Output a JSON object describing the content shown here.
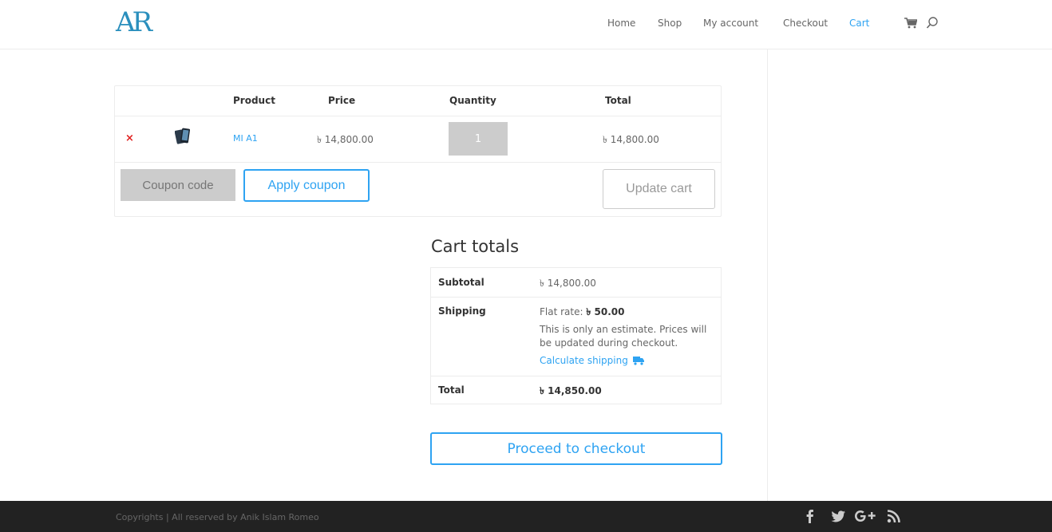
{
  "header": {
    "logo_text": "AR",
    "nav": [
      {
        "label": "Home"
      },
      {
        "label": "Shop"
      },
      {
        "label": "My account"
      },
      {
        "label": "Checkout"
      },
      {
        "label": "Cart",
        "active": true
      }
    ],
    "cart_icon": "shopping-cart-icon",
    "search_icon": "search-icon"
  },
  "cart_table": {
    "headers": [
      "Product",
      "Price",
      "Quantity",
      "Total"
    ],
    "rows": [
      {
        "product_name": "MI A1",
        "price": "৳ 14,800.00",
        "quantity": "1",
        "total": "৳ 14,800.00"
      }
    ],
    "coupon_placeholder": "Coupon code",
    "apply_coupon_label": "Apply coupon",
    "update_cart_label": "Update cart"
  },
  "cart_totals": {
    "title": "Cart totals",
    "subtotal_label": "Subtotal",
    "subtotal_value": "৳ 14,800.00",
    "shipping_label": "Shipping",
    "shipping_method": "Flat rate:",
    "shipping_cost": "৳ 50.00",
    "shipping_note": "This is only an estimate. Prices will be updated during checkout.",
    "calculate_shipping": "Calculate shipping",
    "total_label": "Total",
    "total_value": "৳ 14,850.00",
    "checkout_label": "Proceed to checkout"
  },
  "footer": {
    "copyright": "Copyrights | All reserved by Anik Islam Romeo",
    "social": [
      "facebook-icon",
      "twitter-icon",
      "google-plus-icon",
      "rss-icon"
    ]
  },
  "colors": {
    "accent": "#2ea3f2",
    "remove": "#e0201f",
    "footer_bg": "#222222",
    "input_bg": "#cccccc"
  }
}
